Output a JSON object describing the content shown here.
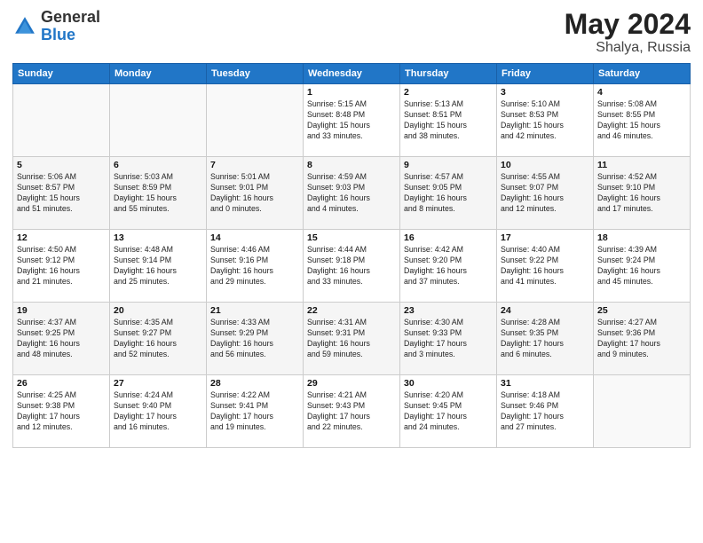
{
  "header": {
    "logo_general": "General",
    "logo_blue": "Blue",
    "title": "May 2024",
    "location": "Shalya, Russia"
  },
  "columns": [
    "Sunday",
    "Monday",
    "Tuesday",
    "Wednesday",
    "Thursday",
    "Friday",
    "Saturday"
  ],
  "weeks": [
    [
      {
        "day": "",
        "info": ""
      },
      {
        "day": "",
        "info": ""
      },
      {
        "day": "",
        "info": ""
      },
      {
        "day": "1",
        "info": "Sunrise: 5:15 AM\nSunset: 8:48 PM\nDaylight: 15 hours\nand 33 minutes."
      },
      {
        "day": "2",
        "info": "Sunrise: 5:13 AM\nSunset: 8:51 PM\nDaylight: 15 hours\nand 38 minutes."
      },
      {
        "day": "3",
        "info": "Sunrise: 5:10 AM\nSunset: 8:53 PM\nDaylight: 15 hours\nand 42 minutes."
      },
      {
        "day": "4",
        "info": "Sunrise: 5:08 AM\nSunset: 8:55 PM\nDaylight: 15 hours\nand 46 minutes."
      }
    ],
    [
      {
        "day": "5",
        "info": "Sunrise: 5:06 AM\nSunset: 8:57 PM\nDaylight: 15 hours\nand 51 minutes."
      },
      {
        "day": "6",
        "info": "Sunrise: 5:03 AM\nSunset: 8:59 PM\nDaylight: 15 hours\nand 55 minutes."
      },
      {
        "day": "7",
        "info": "Sunrise: 5:01 AM\nSunset: 9:01 PM\nDaylight: 16 hours\nand 0 minutes."
      },
      {
        "day": "8",
        "info": "Sunrise: 4:59 AM\nSunset: 9:03 PM\nDaylight: 16 hours\nand 4 minutes."
      },
      {
        "day": "9",
        "info": "Sunrise: 4:57 AM\nSunset: 9:05 PM\nDaylight: 16 hours\nand 8 minutes."
      },
      {
        "day": "10",
        "info": "Sunrise: 4:55 AM\nSunset: 9:07 PM\nDaylight: 16 hours\nand 12 minutes."
      },
      {
        "day": "11",
        "info": "Sunrise: 4:52 AM\nSunset: 9:10 PM\nDaylight: 16 hours\nand 17 minutes."
      }
    ],
    [
      {
        "day": "12",
        "info": "Sunrise: 4:50 AM\nSunset: 9:12 PM\nDaylight: 16 hours\nand 21 minutes."
      },
      {
        "day": "13",
        "info": "Sunrise: 4:48 AM\nSunset: 9:14 PM\nDaylight: 16 hours\nand 25 minutes."
      },
      {
        "day": "14",
        "info": "Sunrise: 4:46 AM\nSunset: 9:16 PM\nDaylight: 16 hours\nand 29 minutes."
      },
      {
        "day": "15",
        "info": "Sunrise: 4:44 AM\nSunset: 9:18 PM\nDaylight: 16 hours\nand 33 minutes."
      },
      {
        "day": "16",
        "info": "Sunrise: 4:42 AM\nSunset: 9:20 PM\nDaylight: 16 hours\nand 37 minutes."
      },
      {
        "day": "17",
        "info": "Sunrise: 4:40 AM\nSunset: 9:22 PM\nDaylight: 16 hours\nand 41 minutes."
      },
      {
        "day": "18",
        "info": "Sunrise: 4:39 AM\nSunset: 9:24 PM\nDaylight: 16 hours\nand 45 minutes."
      }
    ],
    [
      {
        "day": "19",
        "info": "Sunrise: 4:37 AM\nSunset: 9:25 PM\nDaylight: 16 hours\nand 48 minutes."
      },
      {
        "day": "20",
        "info": "Sunrise: 4:35 AM\nSunset: 9:27 PM\nDaylight: 16 hours\nand 52 minutes."
      },
      {
        "day": "21",
        "info": "Sunrise: 4:33 AM\nSunset: 9:29 PM\nDaylight: 16 hours\nand 56 minutes."
      },
      {
        "day": "22",
        "info": "Sunrise: 4:31 AM\nSunset: 9:31 PM\nDaylight: 16 hours\nand 59 minutes."
      },
      {
        "day": "23",
        "info": "Sunrise: 4:30 AM\nSunset: 9:33 PM\nDaylight: 17 hours\nand 3 minutes."
      },
      {
        "day": "24",
        "info": "Sunrise: 4:28 AM\nSunset: 9:35 PM\nDaylight: 17 hours\nand 6 minutes."
      },
      {
        "day": "25",
        "info": "Sunrise: 4:27 AM\nSunset: 9:36 PM\nDaylight: 17 hours\nand 9 minutes."
      }
    ],
    [
      {
        "day": "26",
        "info": "Sunrise: 4:25 AM\nSunset: 9:38 PM\nDaylight: 17 hours\nand 12 minutes."
      },
      {
        "day": "27",
        "info": "Sunrise: 4:24 AM\nSunset: 9:40 PM\nDaylight: 17 hours\nand 16 minutes."
      },
      {
        "day": "28",
        "info": "Sunrise: 4:22 AM\nSunset: 9:41 PM\nDaylight: 17 hours\nand 19 minutes."
      },
      {
        "day": "29",
        "info": "Sunrise: 4:21 AM\nSunset: 9:43 PM\nDaylight: 17 hours\nand 22 minutes."
      },
      {
        "day": "30",
        "info": "Sunrise: 4:20 AM\nSunset: 9:45 PM\nDaylight: 17 hours\nand 24 minutes."
      },
      {
        "day": "31",
        "info": "Sunrise: 4:18 AM\nSunset: 9:46 PM\nDaylight: 17 hours\nand 27 minutes."
      },
      {
        "day": "",
        "info": ""
      }
    ]
  ]
}
